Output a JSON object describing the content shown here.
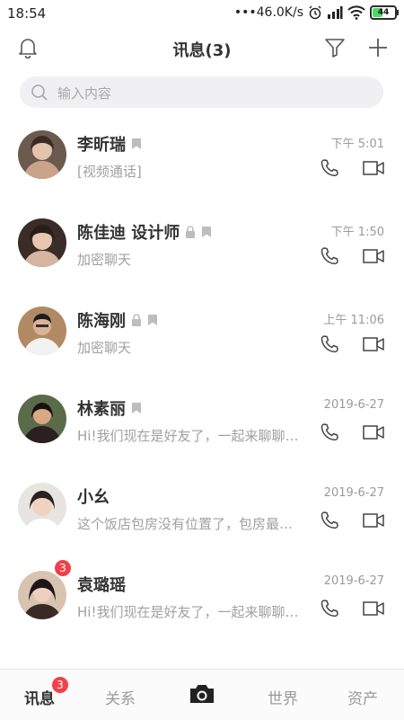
{
  "status_bar": {
    "time": "18:54",
    "network": "•••46.0K/s",
    "battery": "44"
  },
  "header": {
    "title": "讯息(3)"
  },
  "search": {
    "placeholder": "输入内容"
  },
  "messages": [
    {
      "name": "李昕瑞",
      "time": "下午 5:01",
      "preview": "[视频通话]",
      "lock": false,
      "unread": "",
      "avatar_colors": [
        "#6b5a4e",
        "#c9a38a"
      ]
    },
    {
      "name": "陈佳迪 设计师",
      "time": "下午 1:50",
      "preview": "加密聊天",
      "lock": true,
      "unread": "",
      "avatar_colors": [
        "#3a2c27",
        "#d6b4a2"
      ]
    },
    {
      "name": "陈海刚",
      "time": "上午 11:06",
      "preview": "加密聊天",
      "lock": true,
      "unread": "",
      "avatar_colors": [
        "#b18a63",
        "#2f2f36"
      ]
    },
    {
      "name": "林素丽",
      "time": "2019-6-27",
      "preview": "Hi!我们现在是好友了，一起来聊聊吧！",
      "lock": false,
      "unread": "",
      "avatar_colors": [
        "#5a6b4a",
        "#2b1f1f"
      ]
    },
    {
      "name": "小幺",
      "time": "2019-6-27",
      "preview": "这个饭店包房没有位置了，包房最低消费",
      "lock": false,
      "unread": "",
      "avatar_colors": [
        "#e8e4e0",
        "#2a2222"
      ]
    },
    {
      "name": "袁璐瑶",
      "time": "2019-6-27",
      "preview": "Hi!我们现在是好友了，一起来聊聊吧！",
      "lock": false,
      "unread": "3",
      "avatar_colors": [
        "#d8c3b0",
        "#3a2a26"
      ]
    }
  ],
  "tabs": [
    {
      "label": "讯息",
      "active": true,
      "badge": "3"
    },
    {
      "label": "关系",
      "active": false
    },
    {
      "label": "世界",
      "active": false
    },
    {
      "label": "资产",
      "active": false
    }
  ],
  "colors": {
    "badge": "#f0414a",
    "battery": "#4cd964",
    "search_bg": "#f0eff2"
  }
}
